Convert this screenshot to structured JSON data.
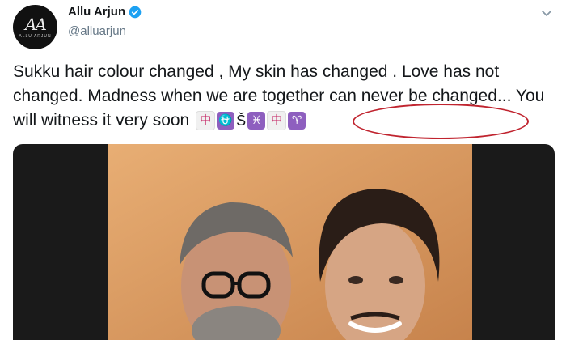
{
  "author": {
    "name": "Allu Arjun",
    "handle": "@alluarjun",
    "avatar_monogram": "AA",
    "avatar_caption": "ALLU ARJUN"
  },
  "tweet": {
    "text": "Sukku hair colour changed , My skin  has changed . Love has not changed. Madness when we are together can never be changed... You will witness it very soon",
    "symbols": [
      "中",
      "⛎",
      "Š",
      "♓",
      "中",
      "♈"
    ]
  },
  "colors": {
    "verified": "#1da1f2",
    "highlight": "#c0242f",
    "symbol_purple": "#8e5fbf"
  },
  "icons": {
    "verified": "verified-badge-icon",
    "menu": "chevron-down-icon"
  }
}
